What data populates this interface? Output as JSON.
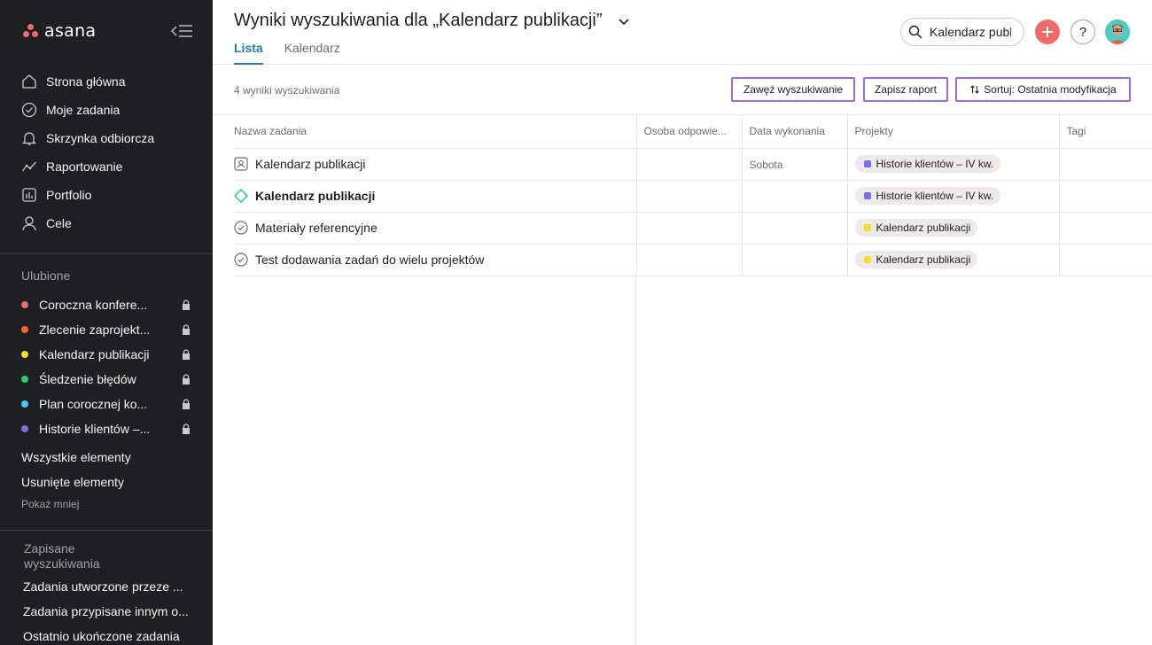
{
  "app": {
    "name": "asana"
  },
  "sidebar": {
    "nav": [
      {
        "label": "Strona główna",
        "icon": "home-icon"
      },
      {
        "label": "Moje zadania",
        "icon": "check-circle-icon"
      },
      {
        "label": "Skrzynka odbiorcza",
        "icon": "bell-icon"
      },
      {
        "label": "Raportowanie",
        "icon": "chart-line-icon"
      },
      {
        "label": "Portfolio",
        "icon": "portfolio-icon"
      },
      {
        "label": "Cele",
        "icon": "person-icon"
      }
    ],
    "favorites_title": "Ulubione",
    "favorites": [
      {
        "label": "Coroczna konfere...",
        "color": "#f06a6a"
      },
      {
        "label": "Zlecenie zaprojekt...",
        "color": "#fd612c"
      },
      {
        "label": "Kalendarz publikacji",
        "color": "#f8df2d"
      },
      {
        "label": "Śledzenie błędów",
        "color": "#5da283"
      },
      {
        "label": "Plan corocznej ko...",
        "color": "#4ecbc4"
      },
      {
        "label": "Historie klientów –...",
        "color": "#7a6ff0"
      }
    ],
    "all_items": "Wszystkie elementy",
    "deleted_items": "Usunięte elementy",
    "show_less": "Pokaż mniej",
    "saved_title": "Zapisane wyszukiwania",
    "saved": [
      "Zadania utworzone przeze ...",
      "Zadania przypisane innym o...",
      "Ostatnio ukończone zadania"
    ]
  },
  "header": {
    "title": "Wyniki wyszukiwania dla „Kalendarz publikacji”",
    "tabs": [
      "Lista",
      "Kalendarz"
    ],
    "search_value": "Kalendarz publikacji",
    "help_label": "?"
  },
  "toolbar": {
    "result_count": "4 wyniki wyszukiwania",
    "refine_label": "Zawęź wyszukiwanie",
    "save_report_label": "Zapisz raport",
    "sort_label": "Sortuj: Ostatnia modyfikacja"
  },
  "table": {
    "columns": [
      "Nazwa zadania",
      "Osoba odpowie...",
      "Data wykonania",
      "Projekty",
      "Tagi"
    ],
    "rows": [
      {
        "name": "Kalendarz publikacji",
        "icon": "approval-icon",
        "bold": false,
        "assignee": "",
        "due": "Sobota",
        "project": "Historie klientów – IV kw.",
        "project_color": "#7a6ff0",
        "tags": ""
      },
      {
        "name": "Kalendarz publikacji",
        "icon": "milestone-icon",
        "bold": true,
        "assignee": "",
        "due": "",
        "project": "Historie klientów – IV kw.",
        "project_color": "#7a6ff0",
        "tags": ""
      },
      {
        "name": "Materiały referencyjne",
        "icon": "check-circle-icon",
        "bold": false,
        "assignee": "",
        "due": "",
        "project": "Kalendarz publikacji",
        "project_color": "#f8df2d",
        "tags": ""
      },
      {
        "name": "Test dodawania zadań do wielu projektów",
        "icon": "check-circle-icon",
        "bold": false,
        "assignee": "",
        "due": "",
        "project": "Kalendarz publikacji",
        "project_color": "#f8df2d",
        "tags": ""
      }
    ]
  }
}
